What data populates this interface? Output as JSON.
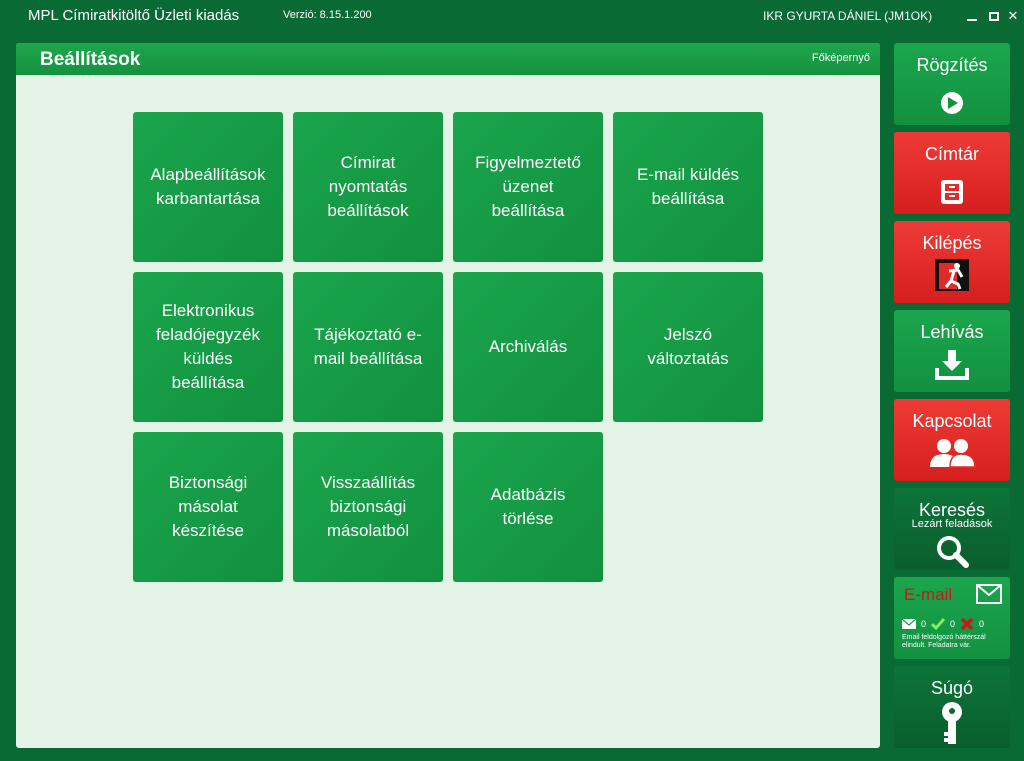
{
  "window": {
    "title": "MPL Címiratkitöltő Üzleti kiadás",
    "version": "Verzió: 8.15.1.200",
    "user": "IKR GYURTA DÁNIEL (JM1OK)",
    "close_symbol": "✕"
  },
  "panel": {
    "title": "Beállítások",
    "home_link": "Főképernyő"
  },
  "tiles": [
    {
      "lines": [
        "Alapbeállítások",
        "karbantartása"
      ]
    },
    {
      "lines": [
        "Címirat",
        "nyomtatás",
        "beállítások"
      ]
    },
    {
      "lines": [
        "Figyelmeztető",
        "üzenet",
        "beállítása"
      ]
    },
    {
      "lines": [
        "E-mail küldés",
        "beállítása"
      ]
    },
    {
      "lines": [
        "Elektronikus",
        "feladójegyzék",
        "küldés",
        "beállítása"
      ]
    },
    {
      "lines": [
        "Tájékoztató e-",
        "mail beállítása"
      ]
    },
    {
      "lines": [
        "Archiválás"
      ]
    },
    {
      "lines": [
        "Jelszó",
        "változtatás"
      ]
    },
    {
      "lines": [
        "Biztonsági",
        "másolat",
        "készítése"
      ]
    },
    {
      "lines": [
        "Visszaállítás",
        "biztonsági",
        "másolatból"
      ]
    },
    {
      "lines": [
        "Adatbázis",
        "törlése"
      ]
    }
  ],
  "sidebar": {
    "record": {
      "label": "Rögzítés",
      "icon": "play-icon"
    },
    "address_book": {
      "label": "Címtár",
      "icon": "cabinet-icon"
    },
    "exit": {
      "label": "Kilépés",
      "icon": "exit-icon"
    },
    "download": {
      "label": "Lehívás",
      "icon": "download-icon"
    },
    "contact": {
      "label": "Kapcsolat",
      "icon": "people-icon"
    },
    "search": {
      "label": "Keresés",
      "sublabel": "Lezárt feladások",
      "icon": "magnifier-icon"
    },
    "email": {
      "label": "E-mail",
      "count_mail": "0",
      "count_ok": "0",
      "count_fail": "0",
      "note": "Email feldolgozó háttérszál elindult. Feladatra vár.",
      "label_color": "#c61a1a"
    },
    "help": {
      "label": "Súgó",
      "icon": "key-icon"
    }
  },
  "colors": {
    "frame": "#0a6a34",
    "tile": "#16994a",
    "panel_bg": "#e3f4e7",
    "red_button": "#e12b2a"
  }
}
